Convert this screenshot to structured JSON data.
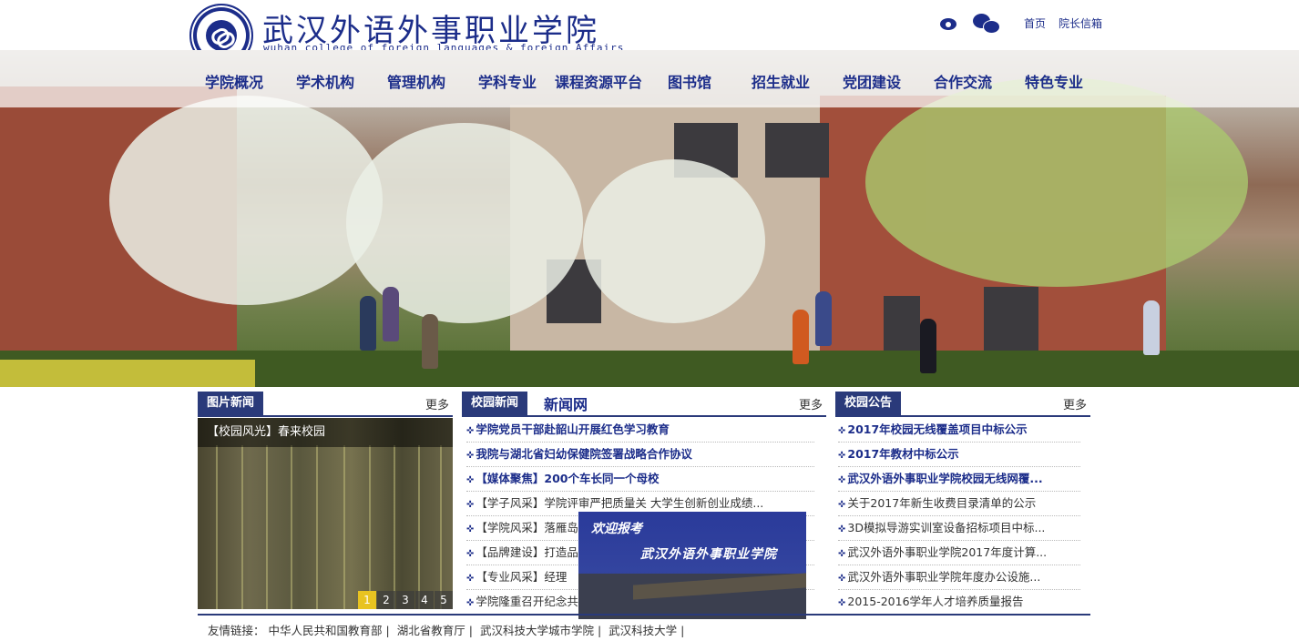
{
  "header": {
    "title": "武汉外语外事职业学院",
    "subtitle": "wuhan college of foreign languages & foreign Affairs",
    "top_links": [
      "首页",
      "院长信箱"
    ],
    "icons": [
      "weibo-icon",
      "wechat-icon"
    ]
  },
  "nav": {
    "items": [
      "学院概况",
      "学术机构",
      "管理机构",
      "学科专业",
      "课程资源平台",
      "图书馆",
      "招生就业",
      "党团建设",
      "合作交流",
      "特色专业"
    ]
  },
  "photo_news": {
    "tab": "图片新闻",
    "more": "更多",
    "caption": "【校园风光】春来校园",
    "pages": [
      "1",
      "2",
      "3",
      "4",
      "5"
    ],
    "active_page": "1"
  },
  "campus_news": {
    "tab": "校园新闻",
    "extra": "新闻网",
    "more": "更多",
    "items": [
      {
        "text": "学院党员干部赴韶山开展红色学习教育",
        "hot": true
      },
      {
        "text": "我院与湖北省妇幼保健院签署战略合作协议",
        "hot": true
      },
      {
        "text": "【媒体聚焦】200个车长同一个母校",
        "hot": true
      },
      {
        "text": "【学子风采】学院评审严把质量关  大学生创新创业成绩...",
        "hot": false
      },
      {
        "text": "【学院风采】落雁岛",
        "hot": false
      },
      {
        "text": "【品牌建设】打造品",
        "hot": false
      },
      {
        "text": "【专业风采】经理",
        "hot": false
      },
      {
        "text": "学院隆重召开纪念共",
        "hot": false
      }
    ]
  },
  "notices": {
    "tab": "校园公告",
    "more": "更多",
    "items": [
      {
        "text": "2017年校园无线覆盖项目中标公示",
        "hot": true
      },
      {
        "text": "2017年教材中标公示",
        "hot": true
      },
      {
        "text": "武汉外语外事职业学院校园无线网覆...",
        "hot": true
      },
      {
        "text": "关于2017年新生收费目录清单的公示",
        "hot": false
      },
      {
        "text": "3D模拟导游实训室设备招标项目中标...",
        "hot": false
      },
      {
        "text": "武汉外语外事职业学院2017年度计算...",
        "hot": false
      },
      {
        "text": "武汉外语外事职业学院年度办公设施...",
        "hot": false
      },
      {
        "text": "2015-2016学年人才培养质量报告",
        "hot": false
      }
    ]
  },
  "popup": {
    "line1": "欢迎报考",
    "line2": "武汉外语外事职业学院"
  },
  "footer": {
    "label": "友情链接：",
    "links": [
      "中华人民共和国教育部",
      "湖北省教育厅",
      "武汉科技大学城市学院",
      "武汉科技大学"
    ]
  },
  "colors": {
    "brand": "#1c2d8a",
    "tab_bg": "#2a3a7a",
    "active_dot": "#e8c321"
  }
}
